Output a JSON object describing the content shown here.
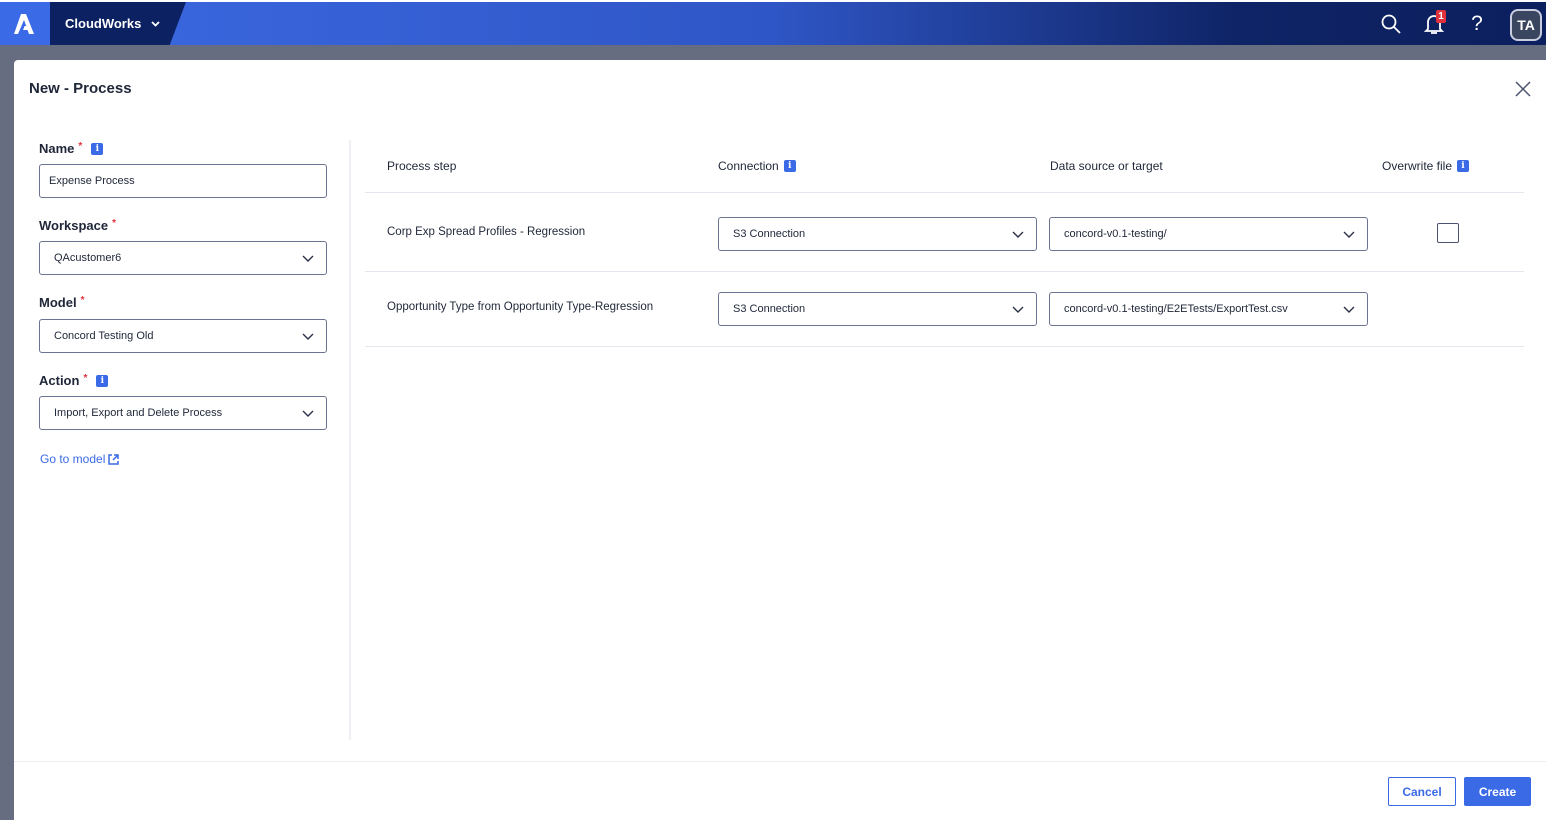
{
  "topbar": {
    "app_name": "CloudWorks",
    "notification_count": "1",
    "avatar_initials": "TA"
  },
  "modal": {
    "title": "New - Process"
  },
  "form": {
    "name_label": "Name",
    "name_value": "Expense Process",
    "workspace_label": "Workspace",
    "workspace_value": "QAcustomer6",
    "model_label": "Model",
    "model_value": "Concord Testing Old",
    "action_label": "Action",
    "action_value": "Import, Export and Delete Process",
    "required_mark": "*",
    "info_glyph": "i",
    "go_to_model": "Go to model"
  },
  "table": {
    "headers": [
      "Process step",
      "Connection",
      "Data source or target",
      "Overwrite file"
    ],
    "rows": [
      {
        "step": "Corp Exp Spread Profiles - Regression",
        "connection": "S3 Connection",
        "data_source": "concord-v0.1-testing/",
        "overwrite": false
      },
      {
        "step": "Opportunity Type from Opportunity Type-Regression",
        "connection": "S3 Connection",
        "data_source": "concord-v0.1-testing/E2ETests/ExportTest.csv"
      }
    ]
  },
  "footer": {
    "cancel": "Cancel",
    "create": "Create"
  },
  "colors": {
    "accent": "#3b6ae6",
    "navy": "#0c2161",
    "required": "#e0323c"
  }
}
